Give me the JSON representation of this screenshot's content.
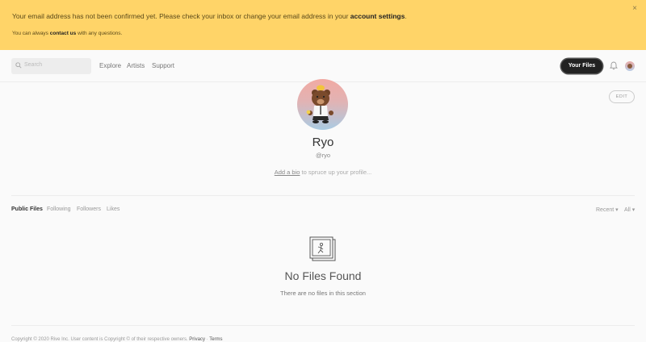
{
  "banner": {
    "message_pre": "Your email address has not been confirmed yet. Please check your inbox or change your email address in your ",
    "message_link": "account settings",
    "message_post": ".",
    "sub_pre": "You can always ",
    "sub_link": "contact us",
    "sub_post": " with any questions.",
    "close": "×",
    "color": "#ffd468"
  },
  "nav": {
    "search_placeholder": "Search",
    "links": [
      "Explore",
      "Artists",
      "Support"
    ],
    "your_files": "Your Files"
  },
  "profile": {
    "edit": "EDIT",
    "name": "Ryo",
    "handle": "@ryo",
    "bio_link": "Add a bio",
    "bio_rest": " to spruce up your profile..."
  },
  "tabs": [
    "Public Files",
    "Following",
    "Followers",
    "Likes"
  ],
  "filters": {
    "sort": "Recent ▾",
    "scope": "All ▾"
  },
  "empty": {
    "title": "No Files Found",
    "subtitle": "There are no files in this section"
  },
  "footer": {
    "text": "Copyright © 2020 Rive Inc. User content is Copyright © of their respective owners. ",
    "privacy": "Privacy",
    "sep": " · ",
    "terms": "Terms"
  }
}
